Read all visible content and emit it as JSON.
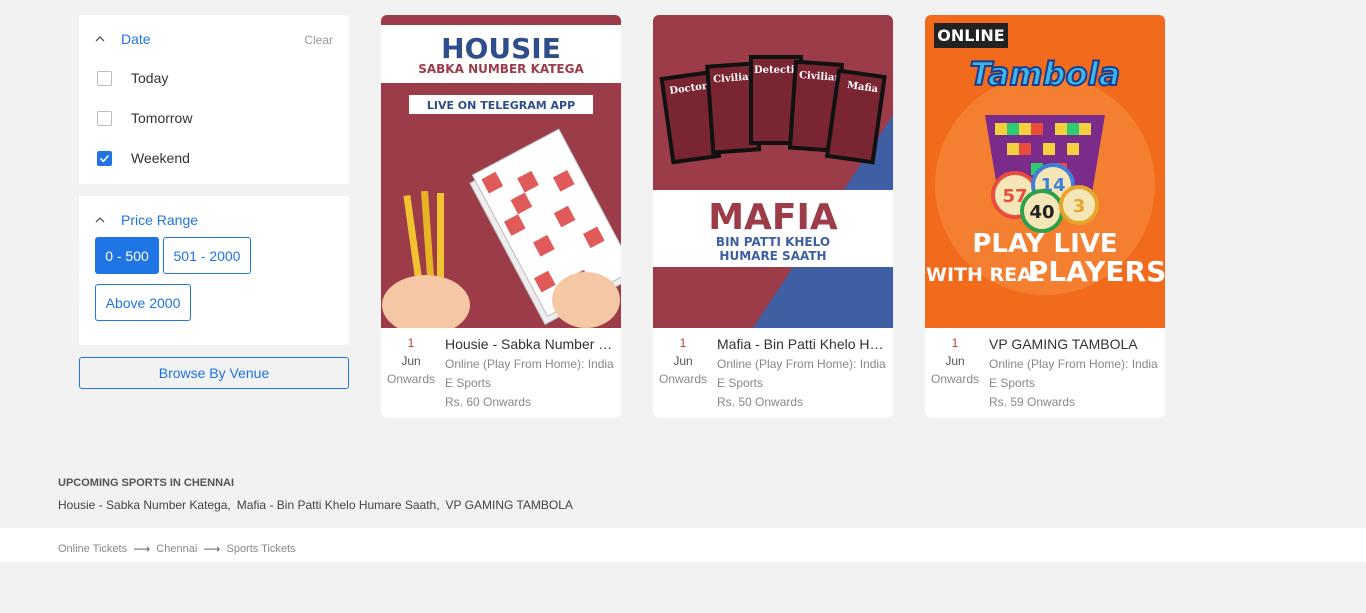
{
  "filters": {
    "date": {
      "title": "Date",
      "clear": "Clear",
      "options": [
        {
          "label": "Today",
          "checked": false
        },
        {
          "label": "Tomorrow",
          "checked": false
        },
        {
          "label": "Weekend",
          "checked": true
        }
      ]
    },
    "price": {
      "title": "Price Range",
      "ranges": [
        {
          "label": "0 - 500",
          "selected": true
        },
        {
          "label": "501 - 2000",
          "selected": false
        },
        {
          "label": "Above 2000",
          "selected": false
        }
      ]
    },
    "browse_venue": "Browse By Venue"
  },
  "events": [
    {
      "title": "Housie - Sabka Number Kategaa",
      "day": "1",
      "month": "Jun",
      "onwards": "Onwards",
      "venue": "Online (Play From Home): India",
      "category": "E Sports",
      "price": "Rs. 60 Onwards",
      "poster": {
        "heading": "HOUSIE",
        "sub": "SABKA NUMBER KATEGA",
        "tag": "LIVE ON TELEGRAM APP",
        "bg": "#9b3c48"
      }
    },
    {
      "title": "Mafia - Bin Patti Khelo Humare Saath",
      "day": "1",
      "month": "Jun",
      "onwards": "Onwards",
      "venue": "Online (Play From Home): India",
      "category": "E Sports",
      "price": "Rs. 50 Onwards",
      "poster": {
        "heading": "MAFIA",
        "sub1": "BIN PATTI KHELO",
        "sub2": "HUMARE SAATH",
        "cards": [
          "Doctor",
          "Civilian",
          "Detective",
          "Civilian",
          "Mafia"
        ],
        "bg": "#9b3c48",
        "accent": "#3e5fa3"
      }
    },
    {
      "title": "VP GAMING TAMBOLA",
      "day": "1",
      "month": "Jun",
      "onwards": "Onwards",
      "venue": "Online (Play From Home): India",
      "category": "E Sports",
      "price": "Rs. 59 Onwards",
      "poster": {
        "badge": "ONLINE",
        "logo": "Tambola",
        "balls": [
          "57",
          "14",
          "40",
          "3"
        ],
        "line1": "PLAY LIVE",
        "line2a": "WITH REAL",
        "line2b": "PLAYERS",
        "bg": "#f26a1b"
      }
    }
  ],
  "upcoming": {
    "title": "UPCOMING SPORTS IN CHENNAI",
    "items": [
      "Housie - Sabka Number Katega,",
      "Mafia - Bin Patti Khelo Humare Saath,",
      "VP GAMING TAMBOLA"
    ]
  },
  "breadcrumb": [
    "Online Tickets",
    "Chennai",
    "Sports Tickets"
  ],
  "colors": {
    "accent": "#1f74e6",
    "date_red": "#c0392b"
  }
}
